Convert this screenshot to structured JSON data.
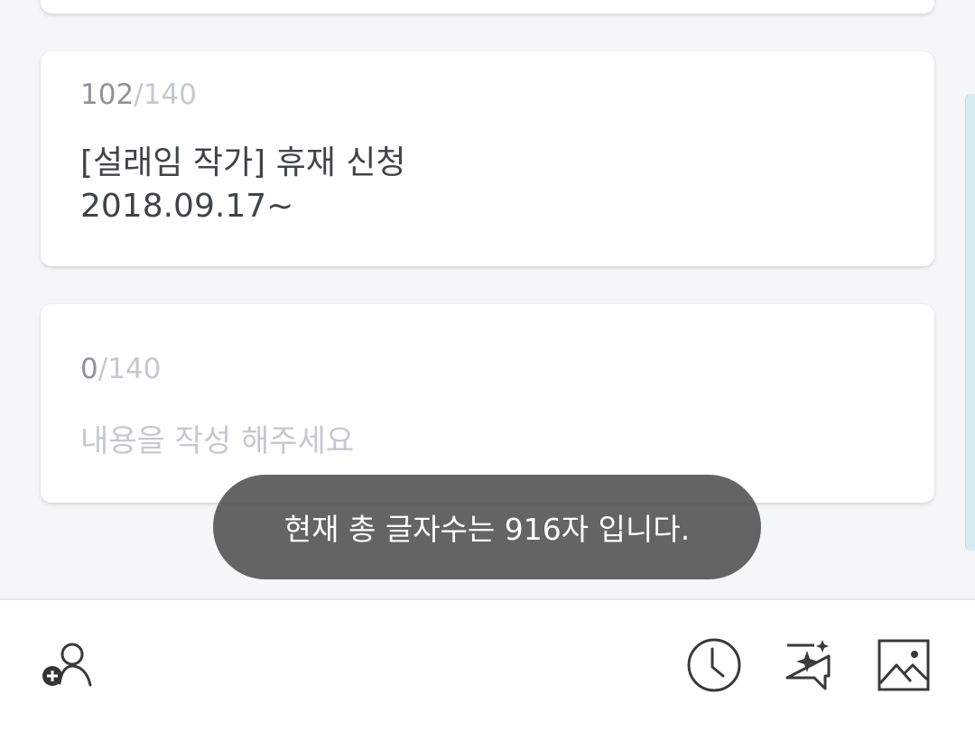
{
  "cards": [
    {
      "count_current": "102",
      "count_separator": "/",
      "count_max": "140",
      "text": "[설래임 작가] 휴재 신청\n2018.09.17~"
    },
    {
      "count_current": "0",
      "count_separator": "/",
      "count_max": "140",
      "placeholder": "내용을 작성 해주세요"
    }
  ],
  "toast": {
    "message": "현재 총 글자수는 916자 입니다."
  },
  "toolbar": {
    "icons": [
      "add-user-icon",
      "clock-icon",
      "sparkle-chat-icon",
      "image-icon"
    ]
  },
  "colors": {
    "background": "#f4f6f8",
    "card": "#ffffff",
    "text": "#3f4448",
    "muted": "#c4c9ce",
    "toast": "#505050",
    "scroll_accent": "#d7ebf4"
  }
}
